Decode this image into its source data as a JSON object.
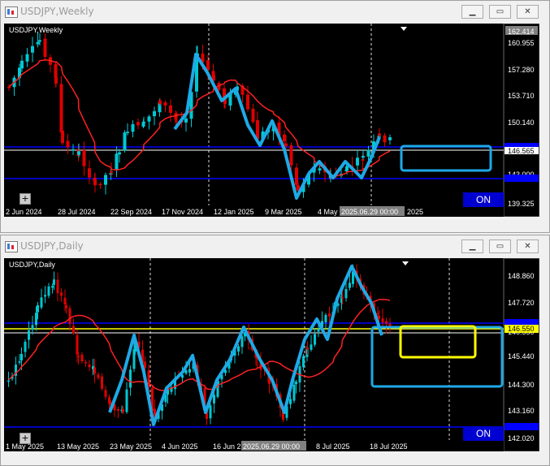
{
  "weekly": {
    "title": "USDJPY,Weekly",
    "symbol_label": "USDJPY,Weekly",
    "price_ticks": [
      "162.414",
      "160.955",
      "157.280",
      "153.710",
      "150.140",
      "146.565",
      "143.000",
      "139.325"
    ],
    "current_price": "146.565",
    "date_ticks": [
      "2 Jun 2024",
      "28 Jul 2024",
      "22 Sep 2024",
      "17 Nov 2024",
      "12 Jan 2025",
      "9 Mar 2025",
      "4 May",
      "2025.06.29 00:00",
      "2025"
    ],
    "on_label": "ON"
  },
  "daily": {
    "title": "USDJPY,Daily",
    "symbol_label": "USDJPY,Daily",
    "price_ticks": [
      "148.860",
      "147.720",
      "146.550",
      "145.440",
      "144.300",
      "143.160",
      "142.020"
    ],
    "current_price": "146.550",
    "date_ticks": [
      "1 May 2025",
      "13 May 2025",
      "23 May 2025",
      "4 Jun 2025",
      "16 Jun 2",
      "2025.06.29 00:00",
      "8 Jul 2025",
      "18 Jul 2025"
    ],
    "on_label": "ON"
  },
  "window_buttons": {
    "minimize": "▁",
    "restore": "▭",
    "close": "✕"
  },
  "colors": {
    "bull": "#00c8d2",
    "bear": "#e00000",
    "ma": "#ff2020",
    "trace": "#1ea9e6",
    "hline": "#0000ff",
    "yellow": "#ffff00"
  }
}
